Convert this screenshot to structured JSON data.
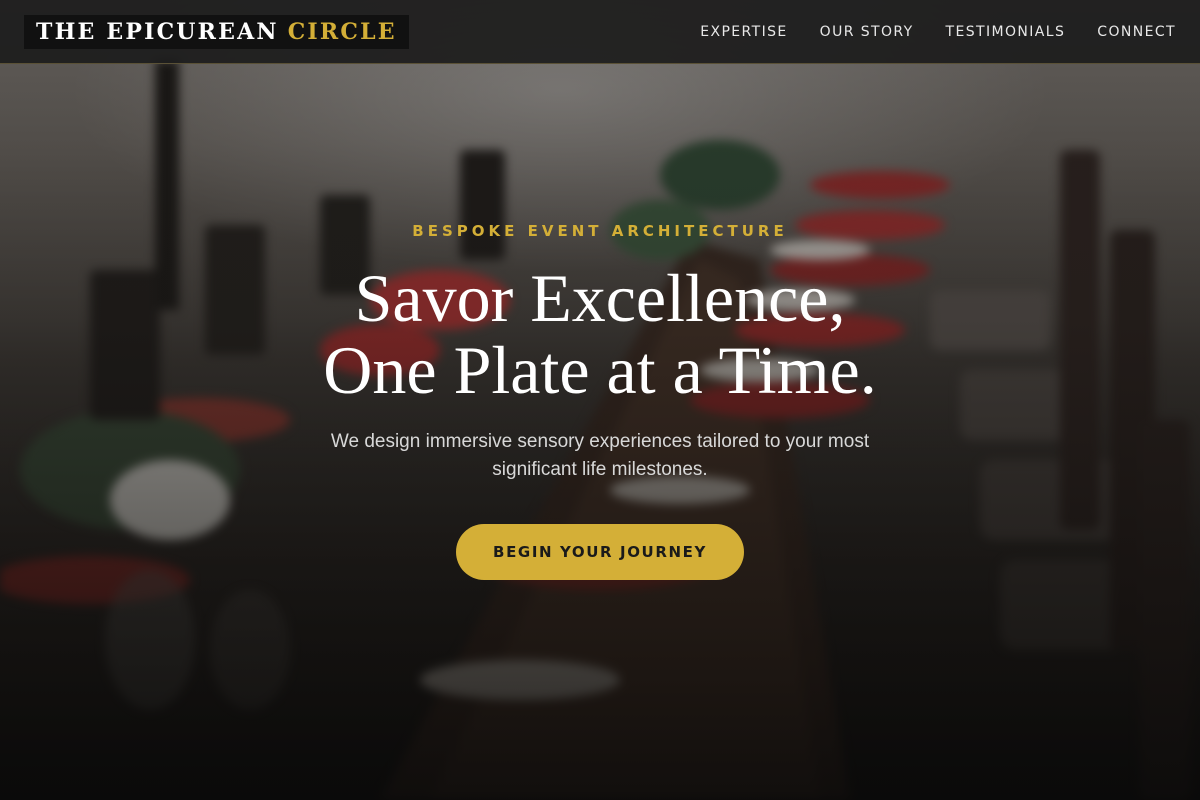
{
  "brand": {
    "name_main": "THE EPICUREAN",
    "name_accent": "CIRCLE"
  },
  "nav": {
    "items": [
      {
        "label": "EXPERTISE"
      },
      {
        "label": "OUR STORY"
      },
      {
        "label": "TESTIMONIALS"
      },
      {
        "label": "CONNECT"
      }
    ]
  },
  "hero": {
    "eyebrow": "BESPOKE EVENT ARCHITECTURE",
    "headline_line1": "Savor Excellence,",
    "headline_line2": "One Plate at a Time.",
    "subtext": "We design immersive sensory experiences tailored to your most significant life milestones.",
    "cta_label": "BEGIN YOUR JOURNEY"
  },
  "colors": {
    "accent": "#d4af37",
    "header_bg": "#1c1c1c",
    "text_primary": "#ffffff"
  }
}
